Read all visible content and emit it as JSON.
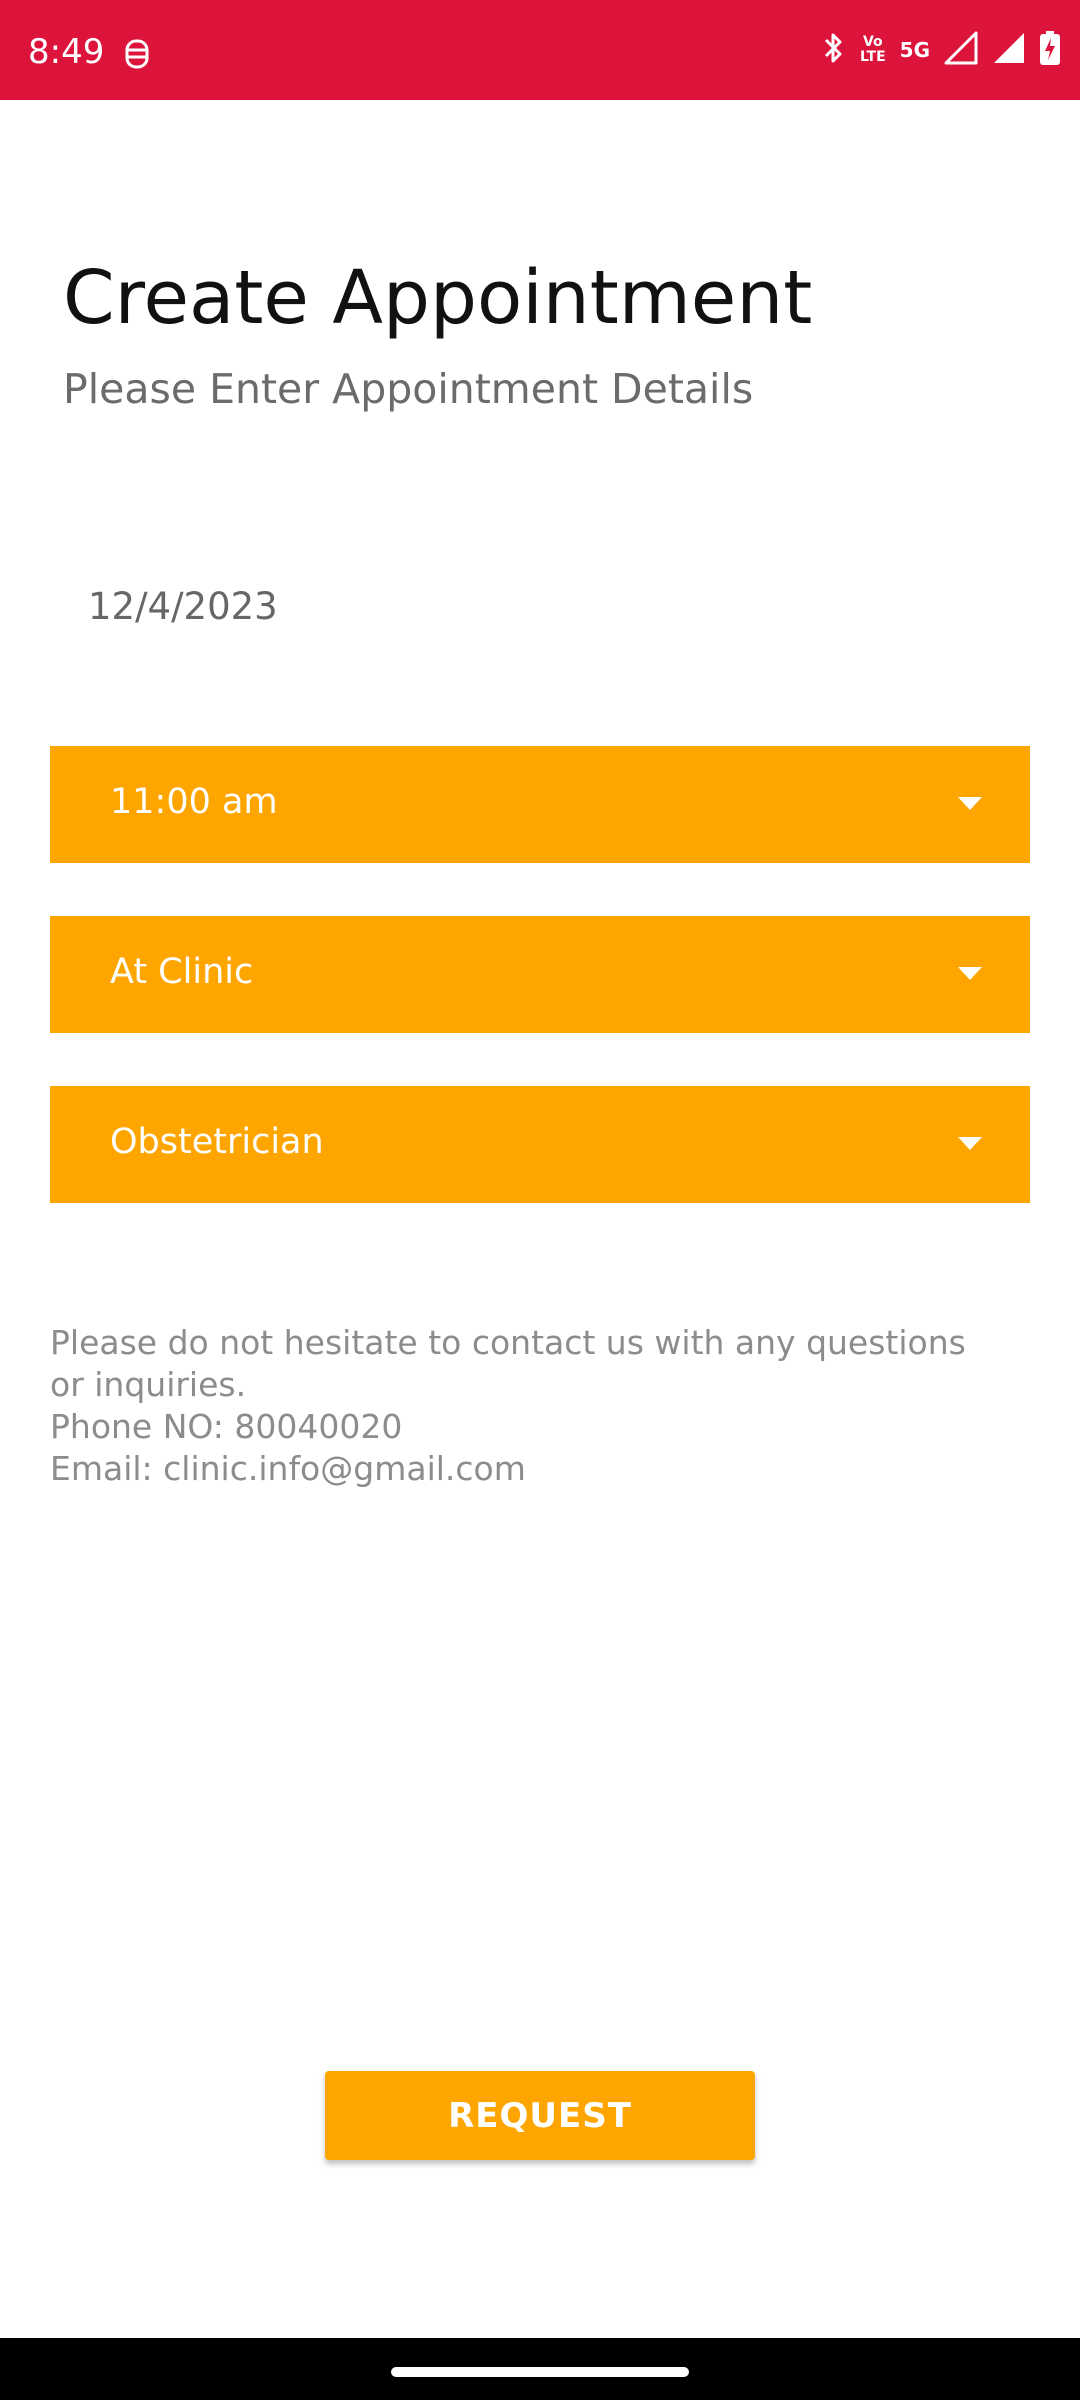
{
  "status_bar": {
    "time": "8:49",
    "volte_top": "Vo",
    "volte_bottom": "LTE",
    "network": "5G",
    "icons": [
      "notification-icon",
      "bluetooth-icon",
      "volte-icon",
      "signal-icon",
      "signal-icon",
      "battery-charging-icon"
    ]
  },
  "header": {
    "title": "Create Appointment",
    "subtitle": "Please Enter Appointment Details"
  },
  "form": {
    "date": "12/4/2023",
    "time_select": "11:00 am",
    "location_select": "At Clinic",
    "specialty_select": "Obstetrician"
  },
  "info": {
    "message": "Please do not hesitate to contact us with any questions or inquiries.",
    "phone": "Phone NO: 80040020",
    "email": "Email: clinic.info@gmail.com"
  },
  "actions": {
    "request_label": "REQUEST"
  },
  "colors": {
    "status_bar": "#dc143c",
    "accent": "#ffa500"
  }
}
